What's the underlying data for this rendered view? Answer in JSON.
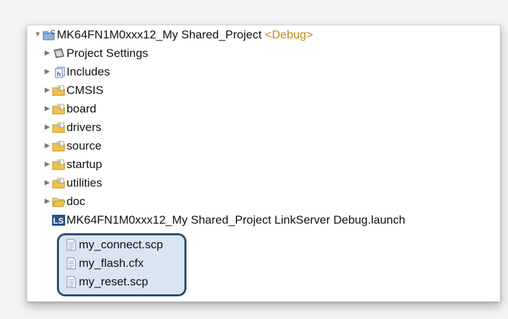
{
  "tree": {
    "project": {
      "name": "MK64FN1M0xxx12_My Shared_Project",
      "config": "<Debug>"
    },
    "folders": [
      {
        "label": "Project Settings",
        "icon": "project-settings-icon"
      },
      {
        "label": "Includes",
        "icon": "includes-icon"
      },
      {
        "label": "CMSIS",
        "icon": "source-folder-icon"
      },
      {
        "label": "board",
        "icon": "source-folder-icon"
      },
      {
        "label": "drivers",
        "icon": "source-folder-icon"
      },
      {
        "label": "source",
        "icon": "source-folder-icon"
      },
      {
        "label": "startup",
        "icon": "source-folder-icon"
      },
      {
        "label": "utilities",
        "icon": "source-folder-icon"
      },
      {
        "label": "doc",
        "icon": "folder-icon"
      }
    ],
    "launch_file": {
      "label": "MK64FN1M0xxx12_My Shared_Project LinkServer Debug.launch",
      "icon": "linkserver-launch-icon",
      "badge": "LS"
    },
    "script_files": [
      {
        "label": "my_connect.scp",
        "icon": "text-file-icon"
      },
      {
        "label": "my_flash.cfx",
        "icon": "text-file-icon"
      },
      {
        "label": "my_reset.scp",
        "icon": "text-file-icon"
      }
    ]
  },
  "colors": {
    "highlight_border": "#2b4d6e",
    "highlight_fill": "#b9d0e6",
    "debug_decoration": "#c68a1a",
    "folder_yellow": "#f2c44a",
    "ls_badge": "#2a4f8c"
  }
}
